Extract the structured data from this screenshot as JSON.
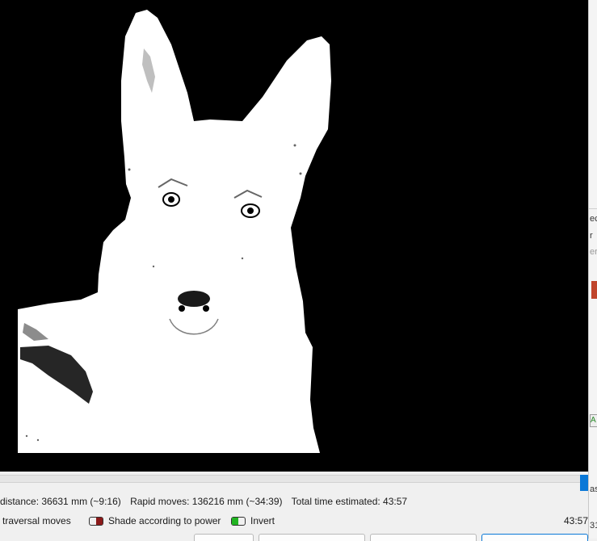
{
  "preview": {
    "background": "#000000",
    "subject": "#ffffff"
  },
  "side_panel": {
    "fragments": [
      "ec",
      "r",
      "er",
      "A",
      "as",
      "31"
    ]
  },
  "progress": {
    "fraction": 0.99,
    "accent": "#0a78d7"
  },
  "status": {
    "distance": "distance: 36631 mm (~9:16)",
    "rapid": "Rapid moves: 136216 mm (~34:39)",
    "total": "Total time estimated: 43:57"
  },
  "options": {
    "traversal_label": "traversal moves",
    "shade_label": "Shade according to power",
    "shade_color": "#8b1a1a",
    "invert_label": "Invert",
    "invert_color": "#22b422",
    "time": "43:57"
  }
}
